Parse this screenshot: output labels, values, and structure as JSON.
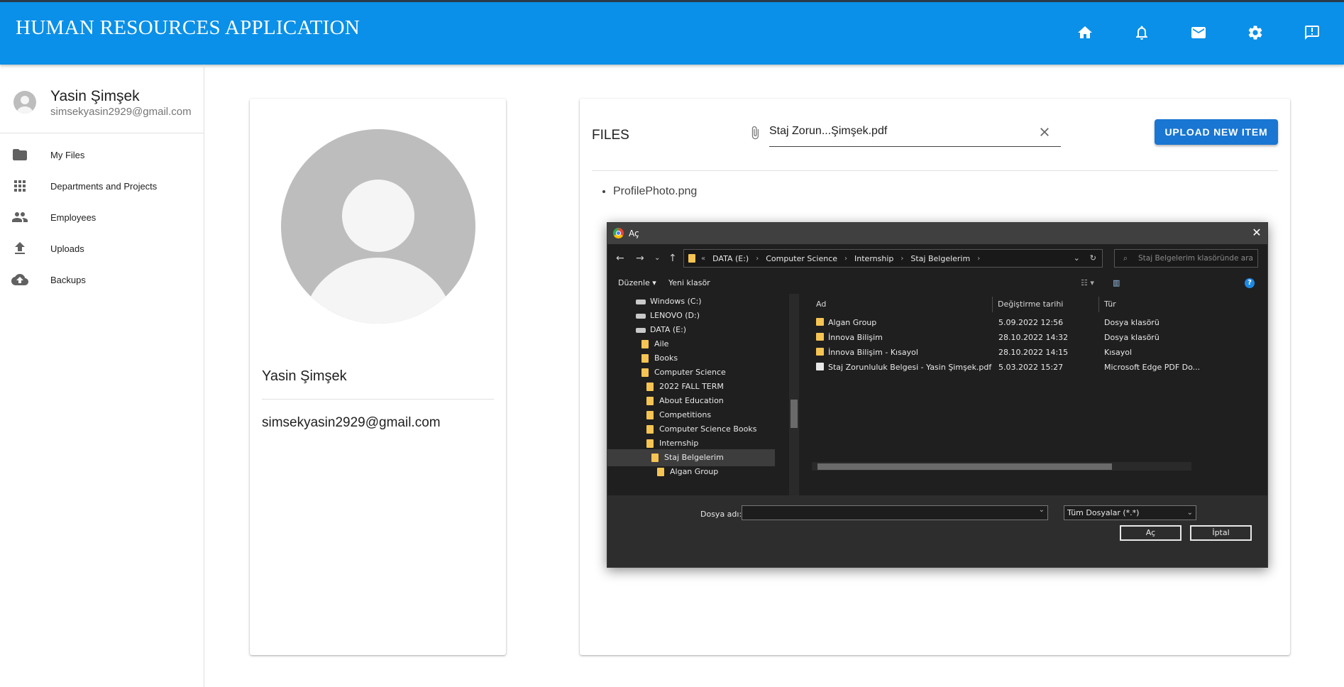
{
  "app": {
    "title": "HUMAN RESOURCES APPLICATION"
  },
  "header_icons": [
    "home-icon",
    "bell-icon",
    "mail-icon",
    "gear-icon",
    "feedback-icon"
  ],
  "sidebar": {
    "user": {
      "name": "Yasin Şimşek",
      "email": "simsekyasin2929@gmail.com"
    },
    "items": [
      {
        "label": "My Files",
        "icon": "folder-icon"
      },
      {
        "label": "Departments and Projects",
        "icon": "apps-grid-icon"
      },
      {
        "label": "Employees",
        "icon": "people-icon"
      },
      {
        "label": "Uploads",
        "icon": "upload-icon"
      },
      {
        "label": "Backups",
        "icon": "cloud-upload-icon"
      }
    ]
  },
  "profile": {
    "name": "Yasin Şimşek",
    "email": "simsekyasin2929@gmail.com"
  },
  "files": {
    "title": "FILES",
    "selected_file": "Staj Zorun...Şimşek.pdf",
    "upload_label": "UPLOAD NEW ITEM",
    "list": [
      "ProfilePhoto.png"
    ]
  },
  "dialog": {
    "title": "Aç",
    "breadcrumb": [
      "DATA (E:)",
      "Computer Science",
      "Internship",
      "Staj Belgelerim"
    ],
    "search_placeholder": "Staj Belgelerim klasöründe ara",
    "toolbar": {
      "organize": "Düzenle",
      "new_folder": "Yeni klasör"
    },
    "tree": [
      {
        "label": "Windows (C:)",
        "type": "drive"
      },
      {
        "label": "LENOVO (D:)",
        "type": "drive"
      },
      {
        "label": "DATA (E:)",
        "type": "drive"
      },
      {
        "label": "Aile",
        "type": "folder"
      },
      {
        "label": "Books",
        "type": "folder"
      },
      {
        "label": "Computer Science",
        "type": "folder"
      },
      {
        "label": "2022 FALL TERM",
        "type": "folder"
      },
      {
        "label": "About Education",
        "type": "folder"
      },
      {
        "label": "Competitions",
        "type": "folder"
      },
      {
        "label": "Computer Science Books",
        "type": "folder"
      },
      {
        "label": "Internship",
        "type": "folder"
      },
      {
        "label": "Staj Belgelerim",
        "type": "folder",
        "selected": true
      },
      {
        "label": "Algan Group",
        "type": "folder"
      }
    ],
    "columns": {
      "name": "Ad",
      "modified": "Değiştirme tarihi",
      "type": "Tür"
    },
    "files": [
      {
        "name": "Algan Group",
        "modified": "5.09.2022 12:56",
        "type": "Dosya klasörü",
        "icon": "folder-icon"
      },
      {
        "name": "İnnova Bilişim",
        "modified": "28.10.2022 14:32",
        "type": "Dosya klasörü",
        "icon": "folder-icon"
      },
      {
        "name": "İnnova Bilişim - Kısayol",
        "modified": "28.10.2022 14:15",
        "type": "Kısayol",
        "icon": "shortcut-icon"
      },
      {
        "name": "Staj Zorunluluk Belgesi - Yasin Şimşek.pdf",
        "modified": "5.03.2022 15:27",
        "type": "Microsoft Edge PDF Do...",
        "icon": "pdf-icon"
      }
    ],
    "filename_label": "Dosya adı:",
    "filename_value": "",
    "filetype": "Tüm Dosyalar (*.*)",
    "open_label": "Aç",
    "cancel_label": "İptal"
  }
}
